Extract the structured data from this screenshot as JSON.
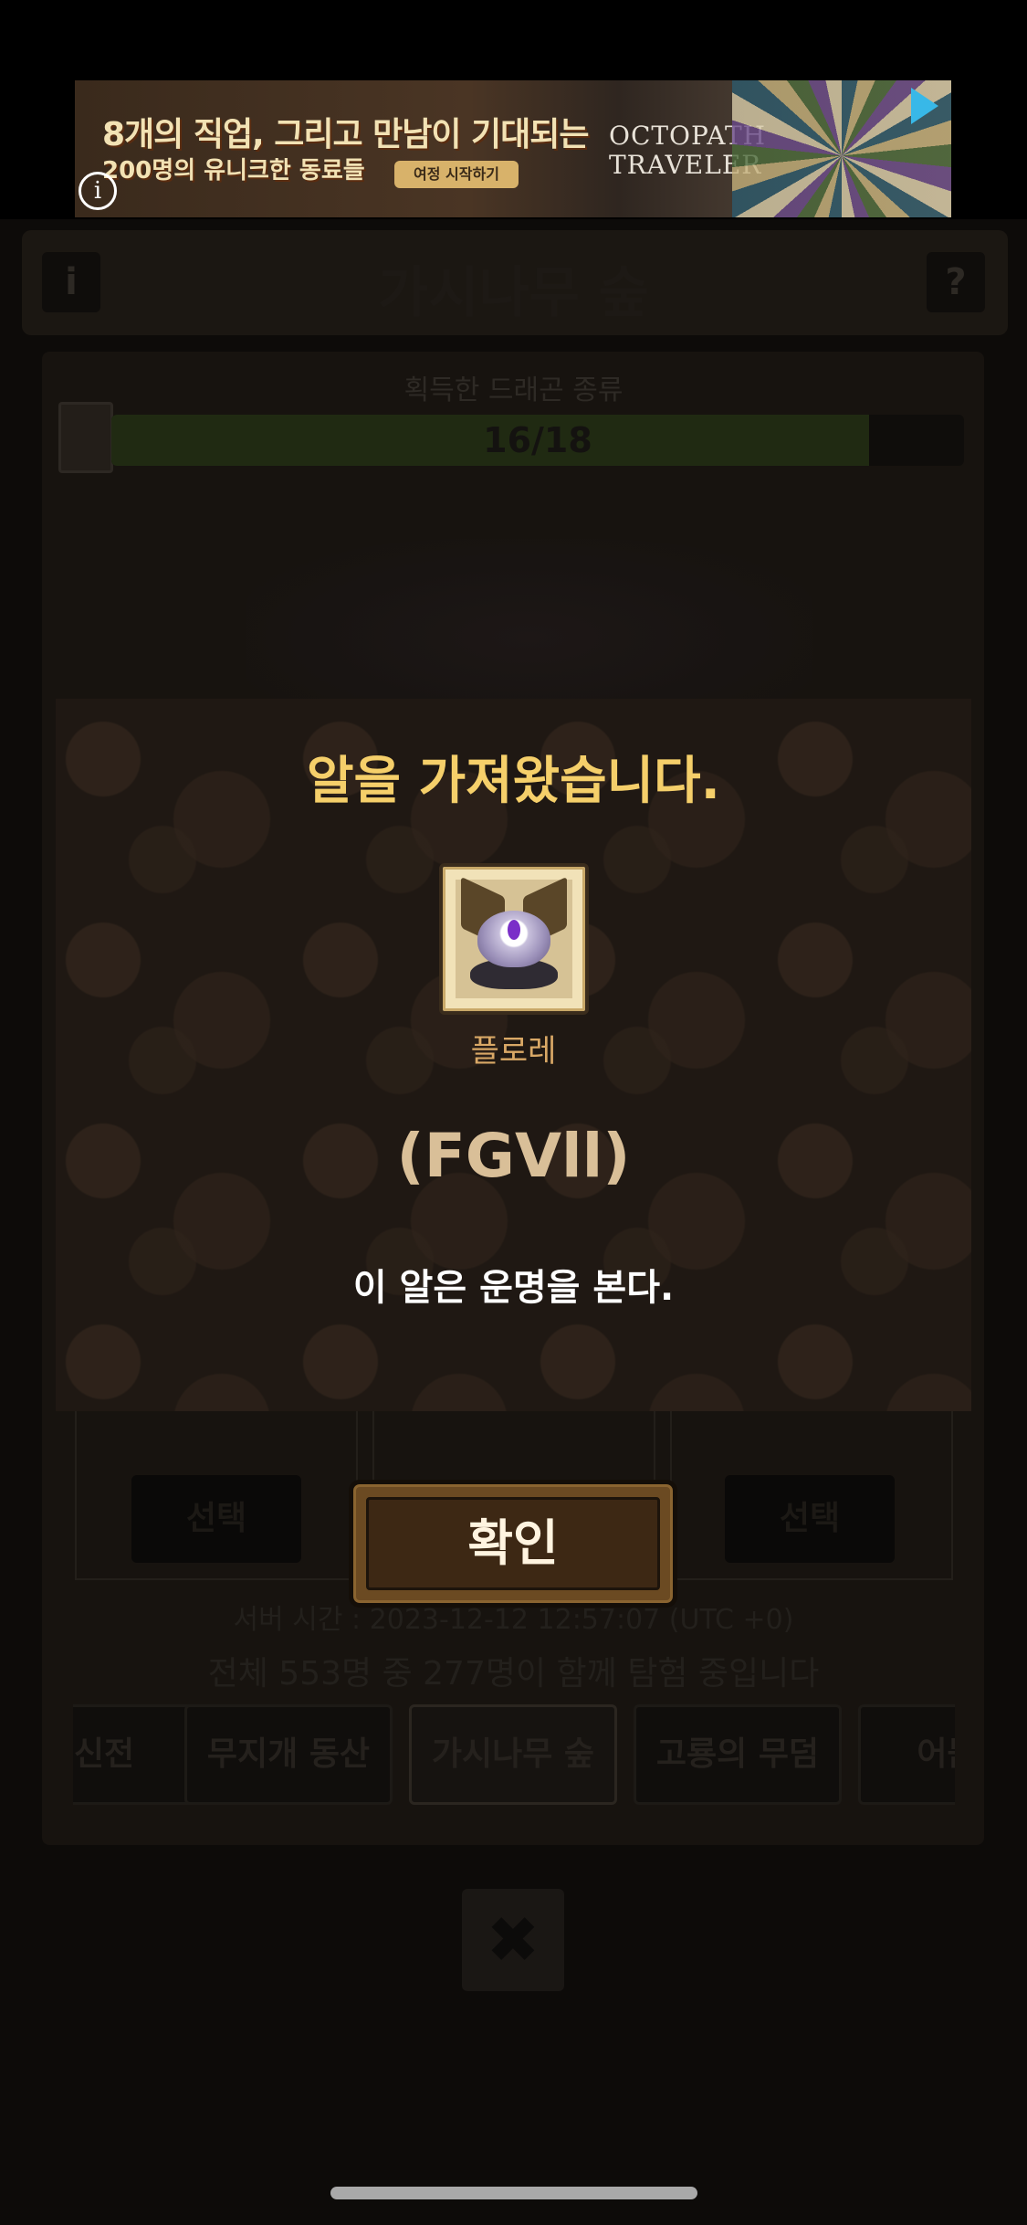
{
  "ad": {
    "line1": "8개의 직업, 그리고 만남이 기대되는",
    "line2": "200명의 유니크한 동료들",
    "cta": "여정 시작하기",
    "logo_line1": "OCTOPATH",
    "logo_line2": "TRAVELER",
    "info_icon": "i"
  },
  "header": {
    "title": "가시나무 숲",
    "info_button": "i",
    "help_button": "?"
  },
  "progress": {
    "caption": "획득한 드래곤 종류",
    "text": "16/18",
    "current": 16,
    "total": 18
  },
  "slots": {
    "select_label_left": "선택",
    "select_label_right": "선택"
  },
  "server": {
    "time": "서버 시간 : 2023-12-12 12:57:07 (UTC +0)",
    "total": "전체 553명 중 277명이 함께 탐험 중입니다"
  },
  "tabs": [
    {
      "label": "신전"
    },
    {
      "label": "무지개 동산"
    },
    {
      "label": "가시나무 숲"
    },
    {
      "label": "고룡의 무덤"
    },
    {
      "label": "어둠의"
    }
  ],
  "modal": {
    "title": "알을 가져왔습니다.",
    "egg_name": "플로레",
    "egg_code": "(FGVll)",
    "description": "이 알은 운명을 본다.",
    "confirm_label": "확인"
  },
  "close_button": "✖",
  "colors": {
    "modal_title": "#f5cf6a",
    "egg_name": "#d9a866",
    "egg_code": "#d9bf98",
    "confirm_text": "#fff4e0"
  },
  "icons": {
    "ad_info": "info-icon",
    "ad_play": "play-icon",
    "book": "book-icon",
    "close": "close-icon"
  }
}
